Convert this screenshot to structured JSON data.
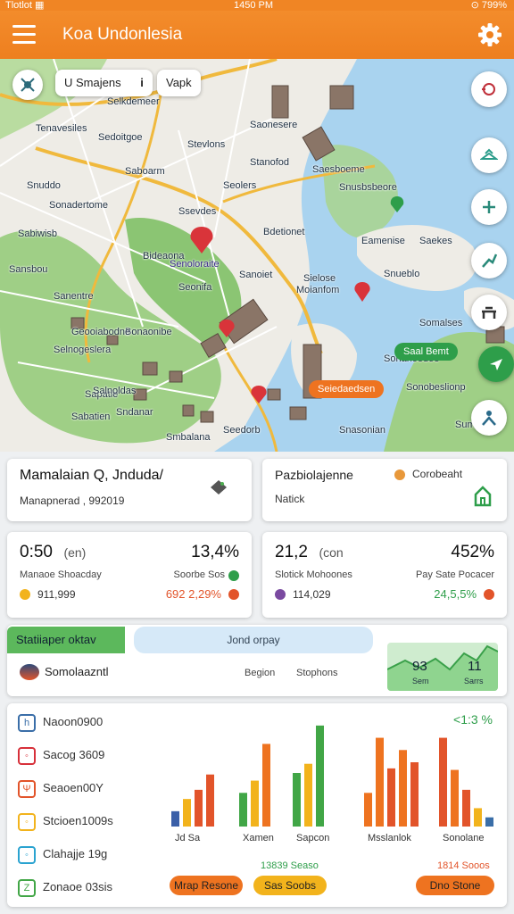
{
  "status": {
    "left": "Tlotlot ▦",
    "time": "1450 PM",
    "right": "⊙ 799%"
  },
  "app": {
    "title": "Koa Undonlesia",
    "accent": "#f08524"
  },
  "map": {
    "chips": [
      "U Smajens",
      "i",
      "Vapk"
    ],
    "labels": [
      "Selkdemeer",
      "Tenavesiles",
      "Sedoitgoe",
      "Saonesere",
      "Stanofod",
      "Stevlons",
      "Saboarm",
      "Sonadertome",
      "Snuddo",
      "Seolers",
      "Saesboeme",
      "Snusbsbeore",
      "Eamenise",
      "Saekes",
      "Ssevdes",
      "Bdetionet",
      "Sonanoedoe",
      "Sonobeslionp",
      "Somalses",
      "Seonifa",
      "Bonaonibe",
      "Selnogeslera",
      "Sabatien",
      "Sapatie",
      "Seedorb",
      "Snasonian",
      "Sielose",
      "Sanentre",
      "Sansbou",
      "Sabiwisb",
      "Bideaona",
      "Sndanar",
      "Snueblo",
      "Sumotte"
    ],
    "place_labels": [
      "Senoloraite",
      "Geooiabodne",
      "Salnoldas",
      "Moianfom",
      "Sanoiet",
      "Smbalana"
    ],
    "pills": {
      "orange": "Seiedaedsen",
      "green": "Saal Bemt"
    }
  },
  "cards": {
    "loc_title": "Mamalaian Q,  Jnduda/",
    "loc_sub": "Manapnerad , 992019",
    "pref_title": "Pazbiolajenne",
    "pref_sub": "Natick",
    "pref_badge": "Corobeaht",
    "stat1": {
      "value": "0:50",
      "unit": "(en)",
      "pct": "13,4%",
      "label": "Manaoe Shoacday",
      "sub": "Soorbe Sos",
      "num": "911,999",
      "badge": "692 2,29%"
    },
    "stat2": {
      "value": "21,2",
      "unit": "(con",
      "pct": "452%",
      "label": "Slotick Mohoones",
      "sub": "Pay Sate Pocacer",
      "num": "114,029",
      "badge": "24,5,5%"
    },
    "strip_tab": "Statiiaper oktav",
    "strip_chip": "Jond orpay",
    "strip_row": "Somolaazntl",
    "strip_cols": [
      "Begion",
      "Stophons"
    ],
    "mini": {
      "a": "93",
      "b": "11",
      "la": "Sem",
      "lb": "Sarrs"
    }
  },
  "legend": [
    {
      "label": "Naoon0900",
      "color": "#3a6ea8",
      "glyph": "h"
    },
    {
      "label": "Sacog 3609",
      "color": "#d7303a",
      "glyph": "◦"
    },
    {
      "label": "Seaoen00Y",
      "color": "#e2542a",
      "glyph": "Ψ"
    },
    {
      "label": "Stcioen1009s",
      "color": "#f2b31c",
      "glyph": "◦"
    },
    {
      "label": "Clahajje 19g",
      "color": "#2aa3d0",
      "glyph": "◦"
    },
    {
      "label": "Zonaoe 03sis",
      "color": "#41a646",
      "glyph": "Z"
    }
  ],
  "chart_data": {
    "type": "bar",
    "right_value": "<1:3 %",
    "categories": [
      "Jd Sa",
      "Xamen",
      "Sapcon",
      "Msslanlok",
      "Sonolane"
    ],
    "groups": [
      {
        "label": "Jd Sa",
        "values": [
          10,
          18,
          24,
          34
        ],
        "colors": [
          "#3a5fa8",
          "#f2b31c",
          "#e2542a",
          "#e2542a"
        ]
      },
      {
        "label": "Xamen",
        "values": [
          22,
          30,
          54
        ],
        "colors": [
          "#41a646",
          "#f2b31c",
          "#ee7320"
        ]
      },
      {
        "label": "Sapcon",
        "values": [
          35,
          41,
          66
        ],
        "colors": [
          "#41a646",
          "#f2b31c",
          "#41a646"
        ]
      },
      {
        "label": "Msslanlok",
        "values": [
          22,
          58,
          38,
          50,
          42
        ],
        "colors": [
          "#ee7320",
          "#ee7320",
          "#e2542a",
          "#ee7320",
          "#e2542a"
        ]
      },
      {
        "label": "Sonolane",
        "values": [
          58,
          37,
          24,
          12,
          6
        ],
        "colors": [
          "#e2542a",
          "#ee7320",
          "#e2542a",
          "#f2b31c",
          "#3a6ea8"
        ]
      }
    ],
    "ylim": [
      0,
      70
    ],
    "footers": [
      "13839 Seaso",
      "1814 Sooos"
    ],
    "buttons": [
      "Mrap Resone",
      "Sas Soobs",
      "Dno Stone"
    ]
  }
}
